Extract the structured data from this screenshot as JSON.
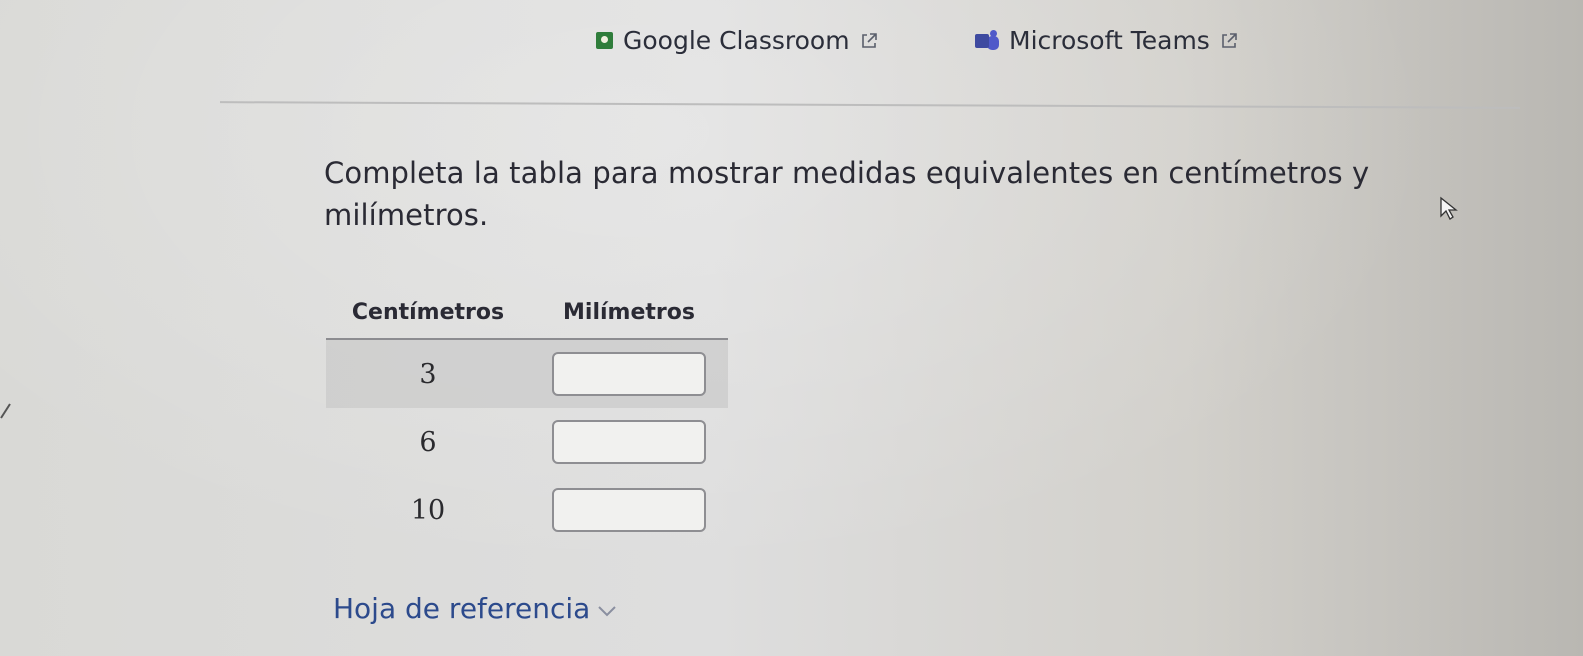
{
  "share": {
    "google_classroom": "Google Classroom",
    "microsoft_teams": "Microsoft Teams"
  },
  "question": {
    "text": "Completa la tabla para mostrar medidas equivalentes en centímetros y milímetros."
  },
  "table": {
    "headers": [
      "Centímetros",
      "Milímetros"
    ],
    "rows": [
      {
        "cm": "3",
        "mm": ""
      },
      {
        "cm": "6",
        "mm": ""
      },
      {
        "cm": "10",
        "mm": ""
      }
    ]
  },
  "reference": {
    "label": "Hoja de referencia"
  },
  "colors": {
    "link": "#2c4a8c",
    "google_classroom_green": "#2f7d3b",
    "teams_purple": "#5059c9"
  },
  "icons": {
    "share_external": "external-link-icon",
    "reference_toggle": "chevron-down-icon"
  }
}
